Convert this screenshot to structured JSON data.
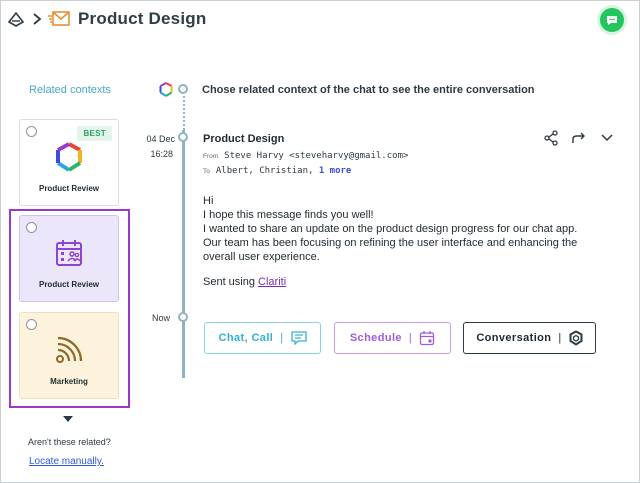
{
  "header": {
    "title": "Product Design",
    "chat_fab_icon": "chat-bubble-icon"
  },
  "left_panel": {
    "title": "Related contexts",
    "cards": [
      {
        "label": "Product Review",
        "badge": "BEST",
        "icon": "hexagon-logo-icon"
      },
      {
        "label": "Product Review",
        "icon": "calendar-people-icon"
      },
      {
        "label": "Marketing",
        "icon": "rss-feed-icon"
      }
    ],
    "question": "Aren't these related?",
    "locate_link": "Locate manually."
  },
  "timeline": {
    "hint": "Chose related context of the chat to see the entire conversation",
    "date": "04 Dec",
    "time": "16:28",
    "now_label": "Now"
  },
  "message": {
    "subject": "Product Design",
    "from_label": "From",
    "from_value": "Steve Harvy <steveharvy@gmail.com>",
    "to_label": "To",
    "to_value": "Albert, Christian,",
    "to_more": "1 more",
    "body_lines": [
      "Hi",
      "I hope this message finds you well!",
      "I wanted to share an update on the product design progress for our chat app.",
      "Our team has been focusing on refining the user interface and enhancing the",
      "overall user experience."
    ],
    "sent_prefix": "Sent using",
    "sent_link": "Clariti"
  },
  "buttons": {
    "chat_call": "Chat, Call",
    "schedule": "Schedule",
    "conversation": "Conversation"
  },
  "colors": {
    "accent_teal": "#34b2d0",
    "accent_purple": "#a35ad6",
    "selection_border": "#9a39c9",
    "timeline": "#8fb3c2",
    "fab_green": "#22c55e"
  }
}
